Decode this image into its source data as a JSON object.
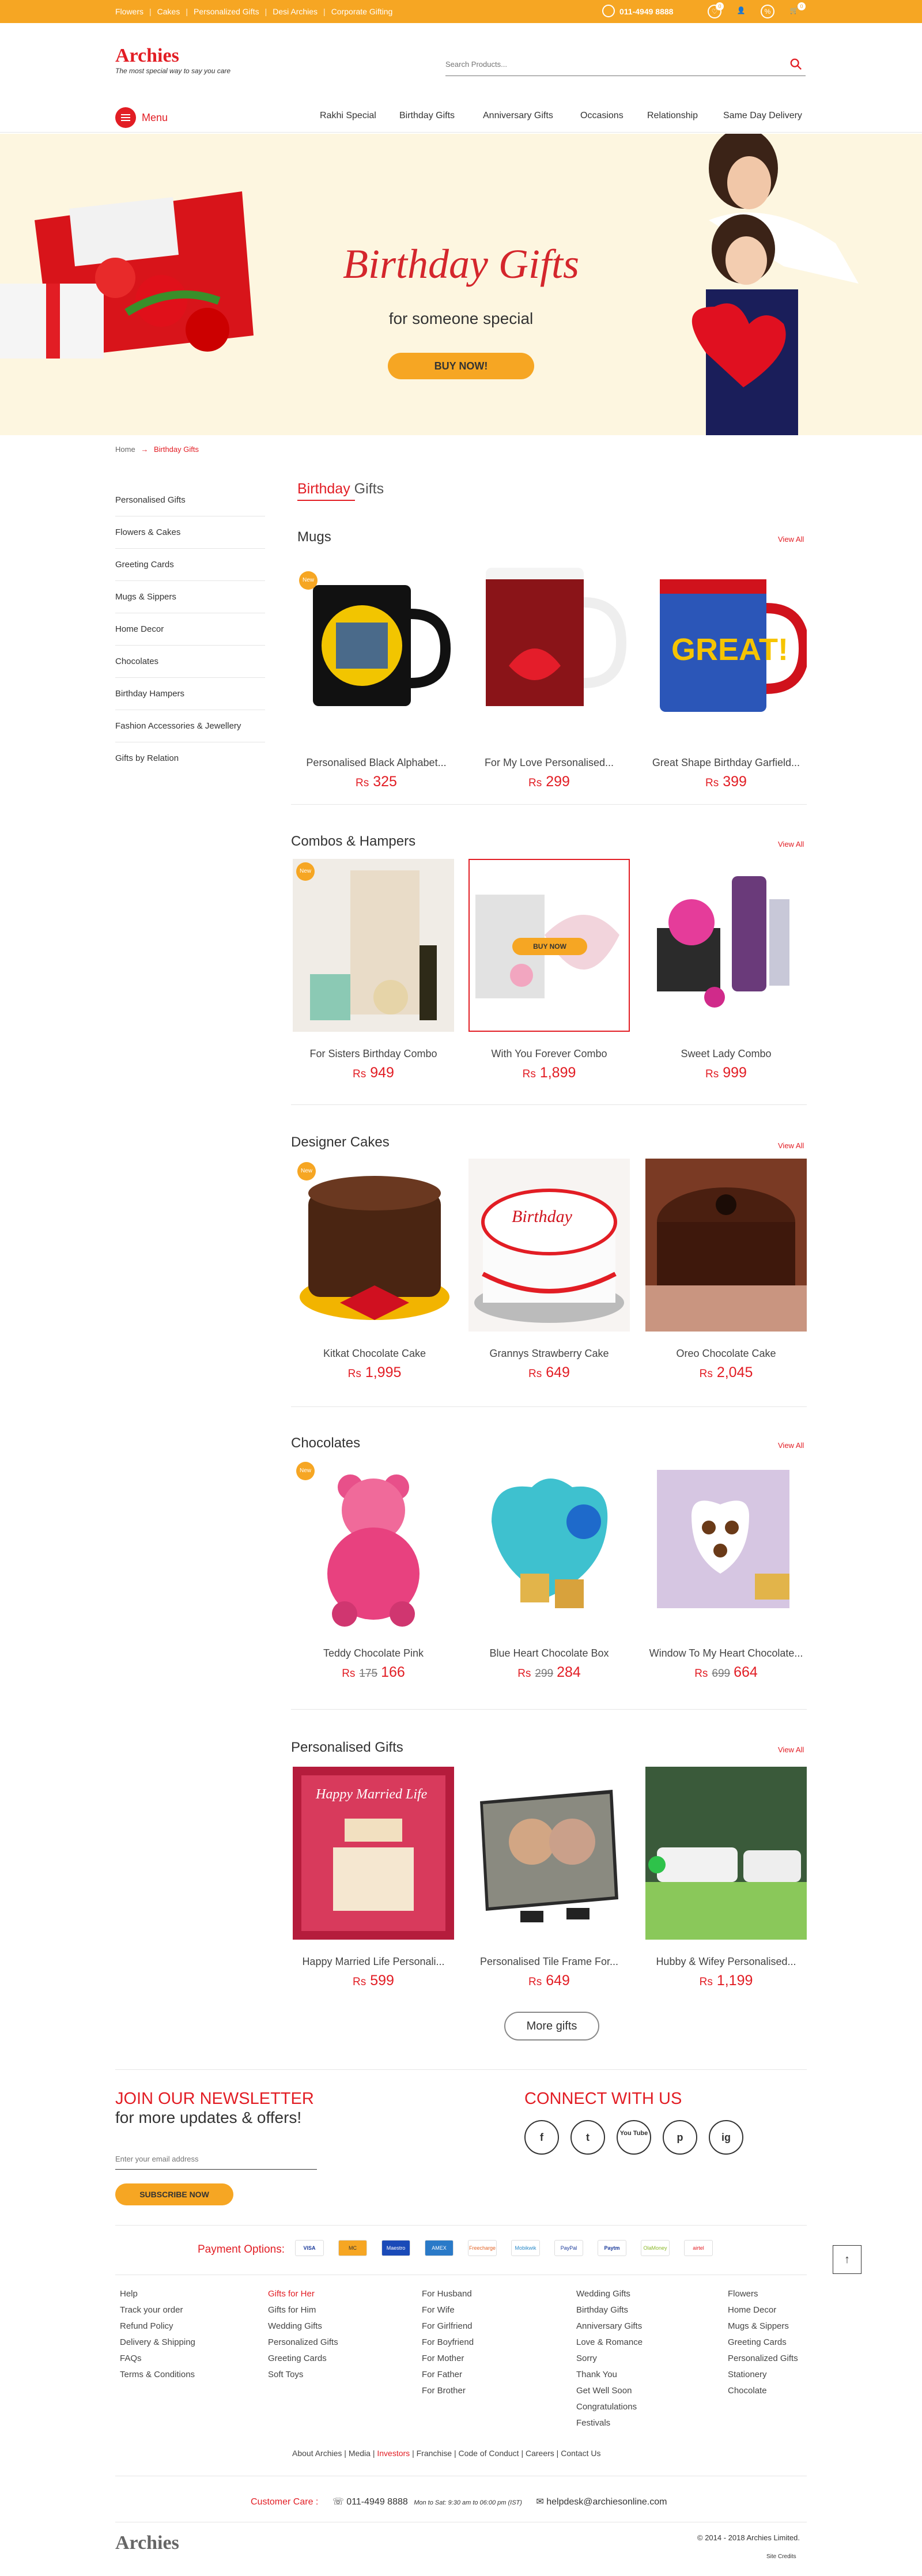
{
  "topbar": {
    "links": [
      "Flowers",
      "Cakes",
      "Personalized Gifts",
      "Desi Archies",
      "Corporate Gifting"
    ],
    "phone": "011-4949 8888",
    "badge1": "0",
    "badge2": "0"
  },
  "header": {
    "logo": "Archies",
    "tagline": "The most special way to say you care",
    "search_placeholder": "Search Products..."
  },
  "menu": {
    "label": "Menu",
    "nav": [
      "Rakhi Special",
      "Birthday Gifts",
      "Anniversary Gifts",
      "Occasions",
      "Relationship",
      "Same Day Delivery"
    ]
  },
  "hero": {
    "title": "Birthday Gifts",
    "subtitle": "for someone special",
    "cta": "BUY NOW!"
  },
  "breadcrumb": {
    "home": "Home",
    "arrow": "→",
    "current": "Birthday Gifts"
  },
  "sidebar": [
    "Personalised Gifts",
    "Flowers & Cakes",
    "Greeting Cards",
    "Mugs & Sippers",
    "Home Decor",
    "Chocolates",
    "Birthday Hampers",
    "Fashion Accessories & Jewellery",
    "Gifts by Relation"
  ],
  "page_title": {
    "red": "Birthday",
    "rest": "Gifts"
  },
  "view_all": "View All",
  "new_badge": "New",
  "currency": "Rs",
  "sections": [
    {
      "title": "Mugs",
      "products": [
        {
          "name": "Personalised Black Alphabet...",
          "price": "325"
        },
        {
          "name": "For My Love Personalised...",
          "price": "299"
        },
        {
          "name": "Great Shape Birthday Garfield...",
          "price": "399"
        }
      ]
    },
    {
      "title": "Combos & Hampers",
      "products": [
        {
          "name": "For Sisters  Birthday Combo",
          "price": "949"
        },
        {
          "name": "With You Forever Combo",
          "price": "1,899",
          "hover": "BUY NOW"
        },
        {
          "name": "Sweet Lady Combo",
          "price": "999"
        }
      ]
    },
    {
      "title": "Designer Cakes",
      "products": [
        {
          "name": "Kitkat Chocolate Cake",
          "price": "1,995"
        },
        {
          "name": "Grannys Strawberry Cake",
          "price": "649"
        },
        {
          "name": "Oreo Chocolate Cake",
          "price": "2,045"
        }
      ]
    },
    {
      "title": "Chocolates",
      "products": [
        {
          "name": "Teddy Chocolate Pink",
          "old": "175",
          "price": "166"
        },
        {
          "name": "Blue Heart Chocolate Box",
          "old": "299",
          "price": "284"
        },
        {
          "name": "Window To My Heart Chocolate...",
          "old": "699",
          "price": "664"
        }
      ]
    },
    {
      "title": "Personalised Gifts",
      "products": [
        {
          "name": "Happy Married Life Personali...",
          "price": "599"
        },
        {
          "name": "Personalised Tile Frame For...",
          "price": "649"
        },
        {
          "name": "Hubby & Wifey Personalised...",
          "price": "1,199"
        }
      ]
    }
  ],
  "more_gifts": "More gifts",
  "newsletter": {
    "heading": "JOIN OUR NEWSLETTER",
    "sub": "for more updates & offers!",
    "placeholder": "Enter your email address",
    "button": "SUBSCRIBE NOW"
  },
  "connect": {
    "heading": "CONNECT WITH US",
    "icons": [
      "f",
      "t",
      "You Tube",
      "p",
      "ig"
    ]
  },
  "payment": {
    "label": "Payment Options:",
    "methods": [
      "VISA",
      "MC",
      "Maestro",
      "AMEX",
      "Freecharge",
      "Mobikwik",
      "PayPal",
      "Paytm",
      "OlaMoney",
      "airtel"
    ]
  },
  "footer_cols": [
    [
      "Help",
      "Track your order",
      "Refund Policy",
      "Delivery & Shipping",
      "FAQs",
      "Terms & Conditions"
    ],
    [
      "Gifts for Her",
      "Gifts for Him",
      "Wedding Gifts",
      "Personalized Gifts",
      "Greeting Cards",
      "Soft Toys"
    ],
    [
      "For Husband",
      "For Wife",
      "For Girlfriend",
      "For Boyfriend",
      "For Mother",
      "For Father",
      "For Brother"
    ],
    [
      "Wedding Gifts",
      "Birthday Gifts",
      "Anniversary Gifts",
      "Love & Romance",
      "Sorry",
      "Thank You",
      "Get Well Soon",
      "Congratulations",
      "Festivals"
    ],
    [
      "Flowers",
      "Home Decor",
      "Mugs & Sippers",
      "Greeting Cards",
      "Personalized Gifts",
      "Stationery",
      "Chocolate"
    ]
  ],
  "footer_links": [
    "About Archies",
    "Media",
    "Investors",
    "Franchise",
    "Code of Conduct",
    "Careers",
    "Contact Us"
  ],
  "care": {
    "label": "Customer Care :",
    "phone": "011-4949 8888",
    "hours": "Mon to Sat: 9:30 am to 06:00 pm (IST)",
    "email": "helpdesk@archiesonline.com"
  },
  "copyright": "© 2014 - 2018 Archies Limited.",
  "site_credit": "Site Credits"
}
